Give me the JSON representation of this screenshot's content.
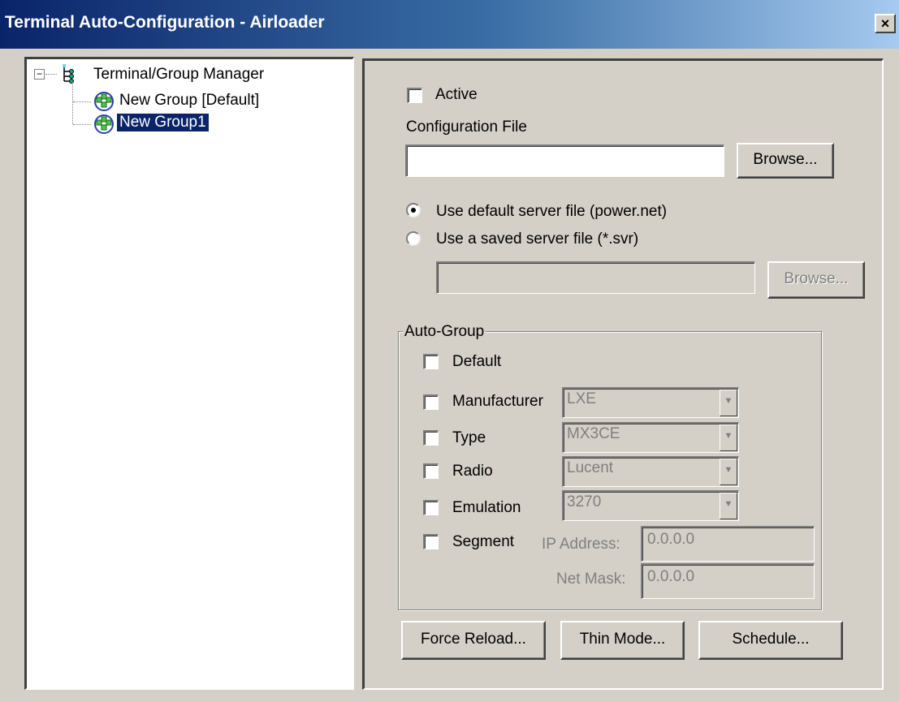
{
  "window": {
    "title": "Terminal Auto-Configuration - Airloader",
    "close_glyph": "×"
  },
  "tree": {
    "root_label": "Terminal/Group Manager",
    "expander_glyph": "−",
    "items": [
      {
        "label": "New Group [Default]",
        "selected": false
      },
      {
        "label": "New Group1",
        "selected": true
      }
    ]
  },
  "config": {
    "active_label": "Active",
    "active_checked": false,
    "file_label": "Configuration File",
    "file_value": "",
    "browse_label": "Browse...",
    "radio_default_label": "Use default server file (power.net)",
    "radio_saved_label": "Use a saved server file (*.svr)",
    "selected_radio": "default",
    "saved_file_value": "",
    "browse_disabled_label": "Browse..."
  },
  "auto_group": {
    "title": "Auto-Group",
    "default_label": "Default",
    "manufacturer_label": "Manufacturer",
    "manufacturer_value": "LXE",
    "type_label": "Type",
    "type_value": "MX3CE",
    "radio_label": "Radio",
    "radio_value": "Lucent",
    "emulation_label": "Emulation",
    "emulation_value": "3270",
    "segment_label": "Segment",
    "ip_label": "IP Address:",
    "ip_value": "0.0.0.0",
    "mask_label": "Net Mask:",
    "mask_value": "0.0.0.0",
    "combo_arrow_glyph": "▼"
  },
  "buttons": {
    "force_reload": "Force Reload...",
    "thin_mode": "Thin Mode...",
    "schedule": "Schedule..."
  }
}
